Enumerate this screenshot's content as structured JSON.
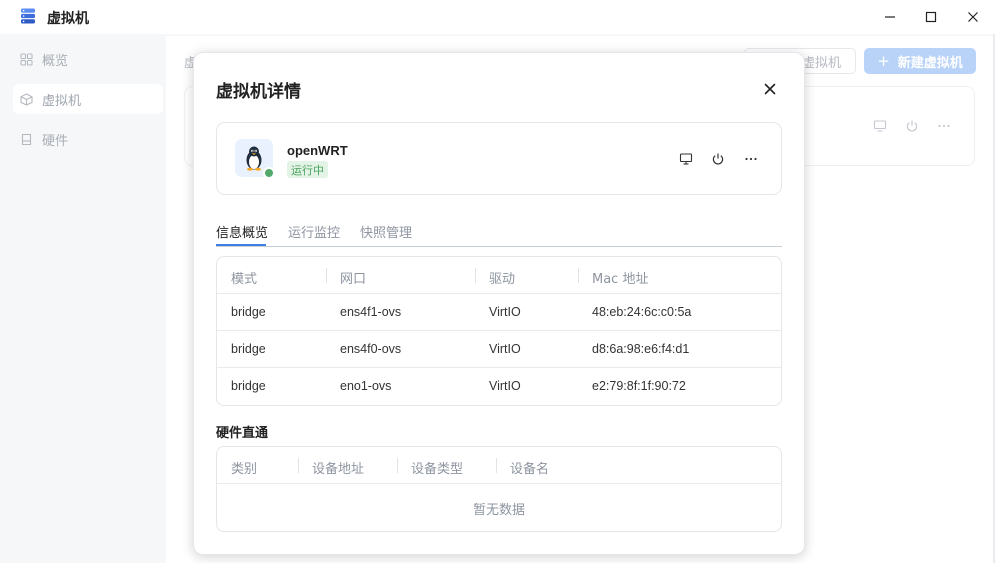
{
  "window": {
    "title": "虚拟机",
    "app_icon": "server-stack-icon",
    "controls": [
      "minimize-icon",
      "maximize-icon",
      "close-icon"
    ]
  },
  "sidebar": {
    "items": [
      {
        "label": "概览",
        "icon": "grid-icon"
      },
      {
        "label": "虚拟机",
        "icon": "cube-icon",
        "active": true
      },
      {
        "label": "硬件",
        "icon": "drive-icon"
      }
    ]
  },
  "background": {
    "crumb": "虚",
    "outline_button": "虚拟机",
    "primary_button": "新建虚拟机",
    "primary_button_icon": "plus-icon"
  },
  "modal": {
    "title": "虚拟机详情",
    "vm": {
      "name": "openWRT",
      "status": "运行中",
      "logo": "linux-penguin-icon",
      "actions": [
        "monitor-icon",
        "power-icon",
        "more-icon"
      ]
    },
    "tabs": [
      {
        "label": "信息概览",
        "active": true
      },
      {
        "label": "运行监控"
      },
      {
        "label": "快照管理"
      }
    ],
    "network_table": {
      "columns": [
        "模式",
        "网口",
        "驱动",
        "Mac 地址"
      ],
      "rows": [
        [
          "bridge",
          "ens4f1-ovs",
          "VirtIO",
          "48:eb:24:6c:c0:5a"
        ],
        [
          "bridge",
          "ens4f0-ovs",
          "VirtIO",
          "d8:6a:98:e6:f4:d1"
        ],
        [
          "bridge",
          "eno1-ovs",
          "VirtIO",
          "e2:79:8f:1f:90:72"
        ]
      ]
    },
    "passthrough": {
      "title": "硬件直通",
      "columns": [
        "类别",
        "设备地址",
        "设备类型",
        "设备名"
      ],
      "empty_text": "暂无数据"
    }
  },
  "colors": {
    "accent": "#3f7fe6",
    "primary_disabled": "#b9d3f8",
    "status_green": "#52a86a",
    "badge_bg": "#e3f4e6"
  }
}
